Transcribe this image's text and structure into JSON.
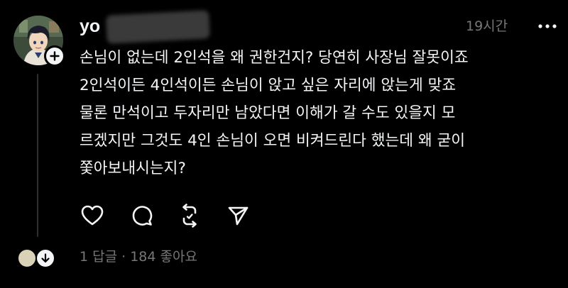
{
  "post": {
    "username": "yo",
    "timestamp": "19시간",
    "text_lines": [
      "손님이 없는데 2인석을 왜 권한건지? 당연히 사장님 잘못이죠",
      "2인석이든 4인석이든 손님이 앉고 싶은 자리에 앉는게 맞죠",
      "물론 만석이고 두자리만 남았다면 이해가 갈 수도 있을지 모",
      "르겠지만 그것도 4인 손님이 오면 비켜드린다 했는데 왜 굳이",
      "쫓아보내시는지?"
    ],
    "more_icon": "more-horizontal-icon"
  },
  "actions": {
    "like_icon": "heart-icon",
    "reply_icon": "comment-icon",
    "repost_icon": "repost-icon",
    "share_icon": "send-icon"
  },
  "stats": {
    "text": "1 답글 · 184 좋아요"
  },
  "colors": {
    "background": "#000000",
    "text_primary": "#f3f5f7",
    "text_secondary": "#777777",
    "thread_line": "#2f2f2f"
  }
}
